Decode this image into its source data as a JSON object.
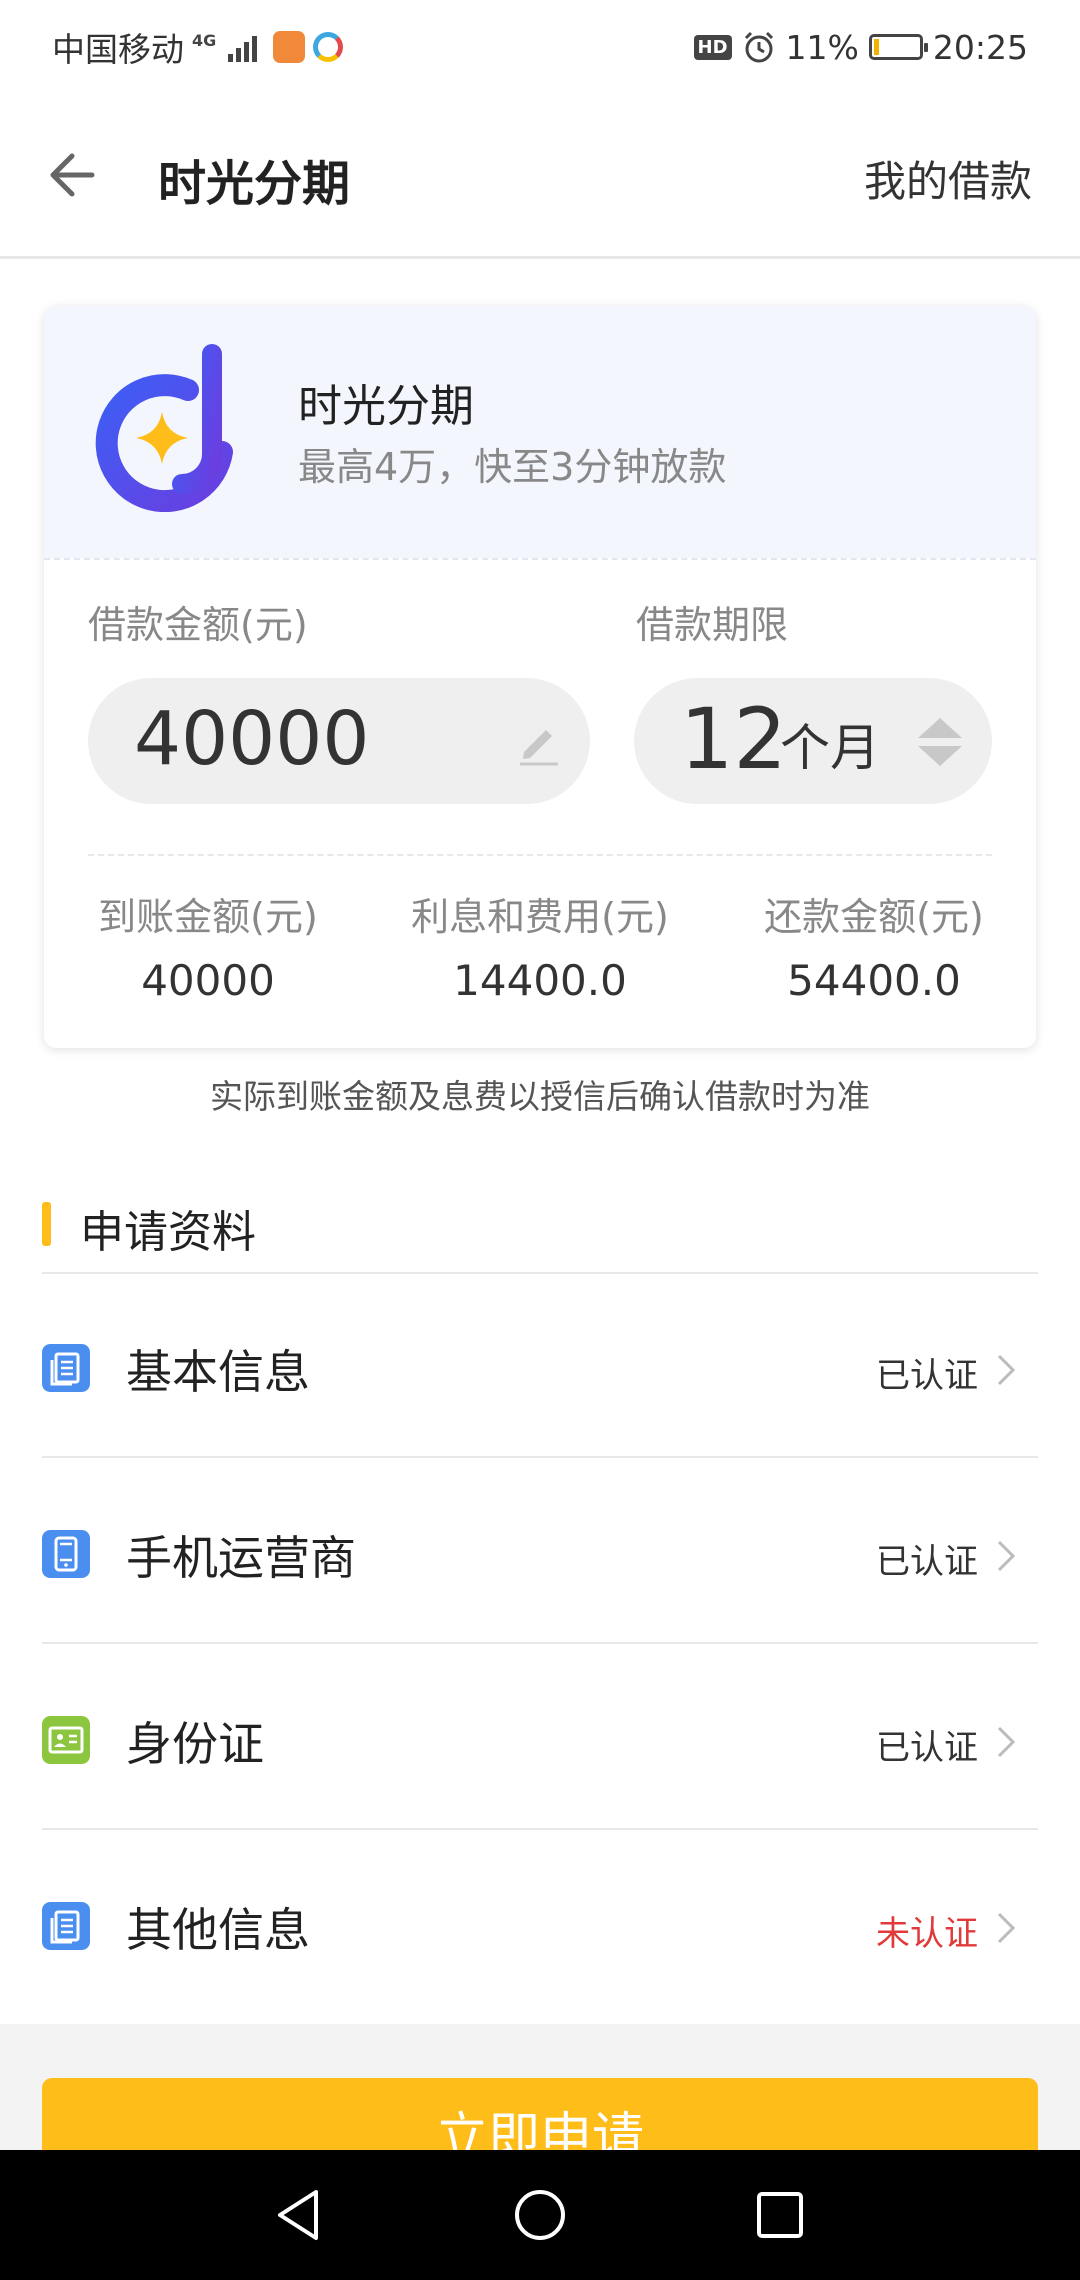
{
  "status_bar": {
    "carrier": "中国移动",
    "network": "4G",
    "battery": "11%",
    "battery_level": 0.11,
    "time": "20:25",
    "hd": "HD"
  },
  "nav": {
    "title": "时光分期",
    "right_link": "我的借款",
    "back_icon": "back-arrow-icon"
  },
  "product": {
    "name": "时光分期",
    "subtitle": "最高4万，快至3分钟放款"
  },
  "loan": {
    "amount_label": "借款金额(元)",
    "amount_value": "40000",
    "term_label": "借款期限",
    "term_value": "12",
    "term_unit": "个月",
    "stats": [
      {
        "label": "到账金额(元)",
        "value": "40000"
      },
      {
        "label": "利息和费用(元)",
        "value": "14400.0"
      },
      {
        "label": "还款金额(元)",
        "value": "54400.0"
      }
    ]
  },
  "disclaimer": "实际到账金额及息费以授信后确认借款时为准",
  "application": {
    "title": "申请资料",
    "items": [
      {
        "label": "基本信息",
        "status": "已认证",
        "icon": "document-icon",
        "color": "#4a8ef0"
      },
      {
        "label": "手机运营商",
        "status": "已认证",
        "icon": "phone-icon",
        "color": "#4a8ef0"
      },
      {
        "label": "身份证",
        "status": "已认证",
        "icon": "id-card-icon",
        "color": "#8cc63f"
      },
      {
        "label": "其他信息",
        "status": "未认证",
        "icon": "document-icon",
        "color": "#4a8ef0"
      }
    ]
  },
  "apply_button": "立即申请",
  "colors": {
    "accent": "#ffbd1a",
    "unverified": "#e03a3a",
    "card_head_bg": "#f4f6fd"
  }
}
